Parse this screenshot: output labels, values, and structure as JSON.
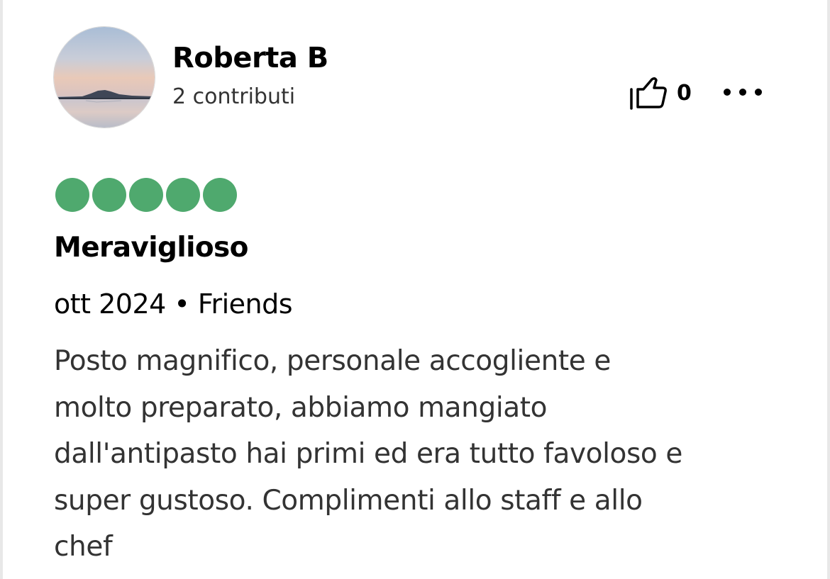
{
  "reviewer": {
    "name": "Roberta B",
    "contributions": "2 contributi"
  },
  "actions": {
    "like_icon": "thumbs-up-icon",
    "like_count": "0",
    "more_icon": "more-horizontal-icon"
  },
  "rating": {
    "value": 5,
    "max": 5,
    "color": "#4fa96e"
  },
  "review": {
    "title": "Meraviglioso",
    "meta": "ott 2024 • Friends",
    "body_lines": [
      "Posto magnifico, personale accogliente e",
      "molto preparato, abbiamo mangiato",
      "dall'antipasto hai primi ed era tutto favoloso e",
      "super gustoso. Complimenti allo staff e allo",
      "chef"
    ]
  }
}
